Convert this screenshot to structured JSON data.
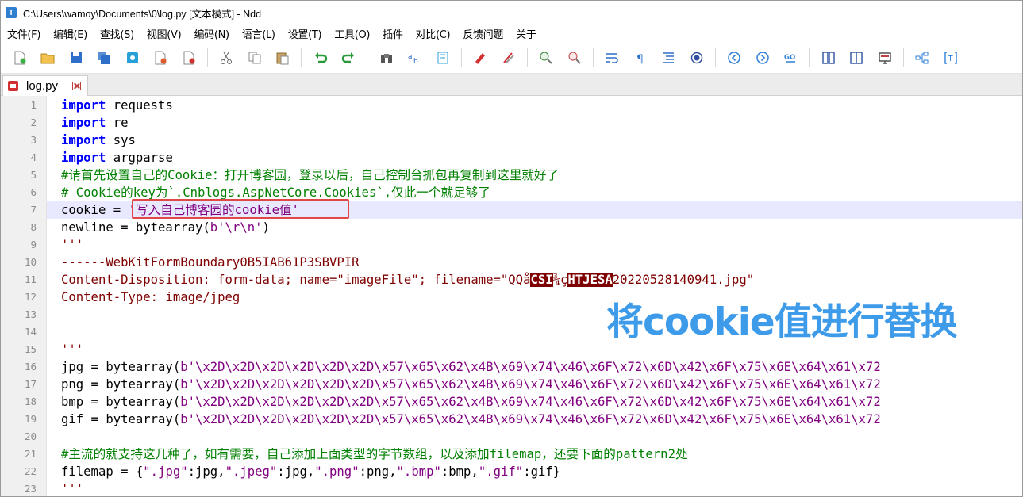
{
  "window": {
    "title": "C:\\Users\\wamoy\\Documents\\0\\log.py [文本模式] - Ndd",
    "app_icon_letter": "T"
  },
  "menu": [
    "文件(F)",
    "编辑(E)",
    "查找(S)",
    "视图(V)",
    "编码(N)",
    "语言(L)",
    "设置(T)",
    "工具(O)",
    "插件",
    "对比(C)",
    "反馈问题",
    "关于"
  ],
  "tab": {
    "label": "log.py"
  },
  "line_numbers": [
    "1",
    "2",
    "3",
    "4",
    "5",
    "6",
    "7",
    "8",
    "9",
    "10",
    "11",
    "12",
    "13",
    "14",
    "15",
    "16",
    "17",
    "18",
    "19",
    "20",
    "21",
    "22",
    "23"
  ],
  "code": {
    "l1_kw": "import",
    "l1_rest": " requests",
    "l2_kw": "import",
    "l2_rest": " re",
    "l3_kw": "import",
    "l3_rest": " sys",
    "l4_kw": "import",
    "l4_rest": " argparse",
    "l5": "#请首先设置自己的Cookie：打开博客园，登录以后，自己控制台抓包再复制到这里就好了",
    "l6": "# Cookie的key为`.Cnblogs.AspNetCore.Cookies`,仅此一个就足够了",
    "l7_pre": "cookie = ",
    "l7_str": "'写入自己博客园的cookie值'",
    "l8_pre": "newline = bytearray(",
    "l8_str": "b'\\r\\n'",
    "l8_post": ")",
    "l9": "'''",
    "l10": "------WebKitFormBoundary0B5IAB61P3SBVPIR",
    "l11_pre": "Content-Disposition: form-data; name=\"imageFile\"; filename=\"QQå",
    "l11_ctl1": "CSI",
    "l11_mid": "¾ç",
    "l11_ctl2": "HTJ",
    "l11_ctl3": "ESA",
    "l11_post": "20220528140941.jpg\"",
    "l12": "Content-Type: image/jpeg",
    "l15": "'''",
    "l16_pre": "jpg = bytearray(",
    "l17_pre": "png = bytearray(",
    "l18_pre": "bmp = bytearray(",
    "l19_pre": "gif = bytearray(",
    "bytes_str": "b'\\x2D\\x2D\\x2D\\x2D\\x2D\\x2D\\x57\\x65\\x62\\x4B\\x69\\x74\\x46\\x6F\\x72\\x6D\\x42\\x6F\\x75\\x6E\\x64\\x61\\x72",
    "l21": "#主流的就支持这几种了，如有需要，自己添加上面类型的字节数组，以及添加filemap，还要下面的pattern2处",
    "l22_pre": "filemap = {",
    "l22_s1": "\".jpg\"",
    "l22_p1": ":jpg,",
    "l22_s2": "\".jpeg\"",
    "l22_p2": ":jpg,",
    "l22_s3": "\".png\"",
    "l22_p3": ":png,",
    "l22_s4": "\".bmp\"",
    "l22_p4": ":bmp,",
    "l22_s5": "\".gif\"",
    "l22_p5": ":gif}",
    "l23": "'''"
  },
  "annotation": "将cookie值进行替换",
  "colors": {
    "keyword": "#0000ff",
    "comment": "#008000",
    "string": "#800080",
    "docstring": "#7f0000",
    "current_line": "#e8e8ff",
    "annotation": "#3d9be9",
    "highlight_box": "#e04848"
  }
}
